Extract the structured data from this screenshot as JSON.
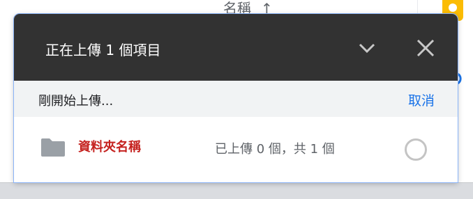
{
  "background": {
    "column_header": "名稱",
    "sort_arrow": "↑"
  },
  "upload_panel": {
    "title": "正在上傳 1 個項目",
    "minimize_icon": "chevron-down-icon",
    "close_icon": "close-icon",
    "status_text": "剛開始上傳...",
    "cancel_label": "取消",
    "items": [
      {
        "icon": "folder-icon",
        "name": "資料夾名稱",
        "progress": "已上傳 0 個，共 1 個"
      }
    ]
  },
  "colors": {
    "header_bg": "#323232",
    "accent": "#1a73e8",
    "item_name": "#c5221f",
    "status_bg": "#f1f3f4"
  }
}
